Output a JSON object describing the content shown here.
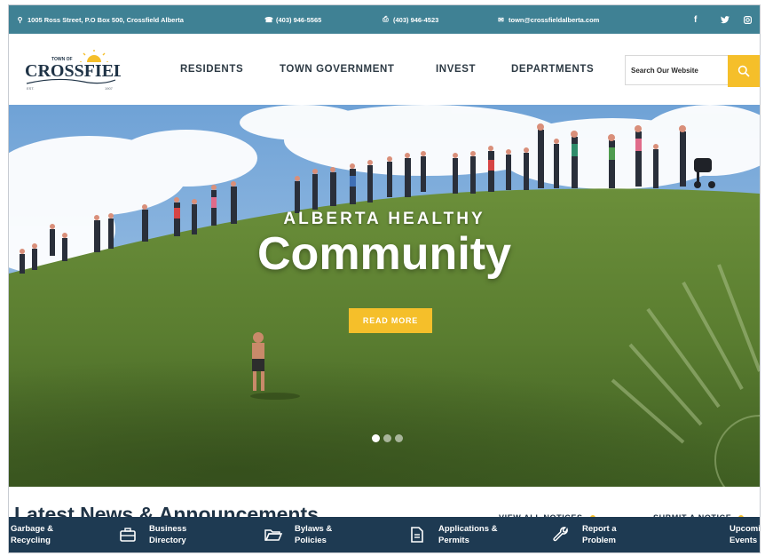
{
  "topbar": {
    "address": "1005 Ross Street, P.O Box 500, Crossfield Alberta",
    "phone": "(403) 946-5565",
    "fax": "(403) 946-4523",
    "email": "town@crossfieldalberta.com",
    "social": [
      "f",
      "t",
      "i"
    ]
  },
  "logo": {
    "main": "CROSSFIELD",
    "small": "TOWN OF",
    "sub_left": "EST.",
    "sub_right": "1907"
  },
  "nav": {
    "items": [
      "RESIDENTS",
      "TOWN GOVERNMENT",
      "INVEST",
      "DEPARTMENTS"
    ]
  },
  "search": {
    "placeholder": "Search Our Website"
  },
  "hero": {
    "kicker": "ALBERTA HEALTHY",
    "title": "Community",
    "button": "READ MORE"
  },
  "news": {
    "title": "Latest News & Announcements",
    "link_notices": "VIEW ALL NOTICES",
    "link_submit": "SUBMIT A NOTICE"
  },
  "quick_links": {
    "items": [
      "Garbage &\nRecycling",
      "Business\nDirectory",
      "Bylaws &\nPolicies",
      "Applications &\nPermits",
      "Report a\nProblem",
      "Upcoming\nEvents"
    ]
  },
  "colors": {
    "topbar": "#3f8194",
    "accent": "#f5bf2a",
    "navy": "#1e3a52"
  }
}
